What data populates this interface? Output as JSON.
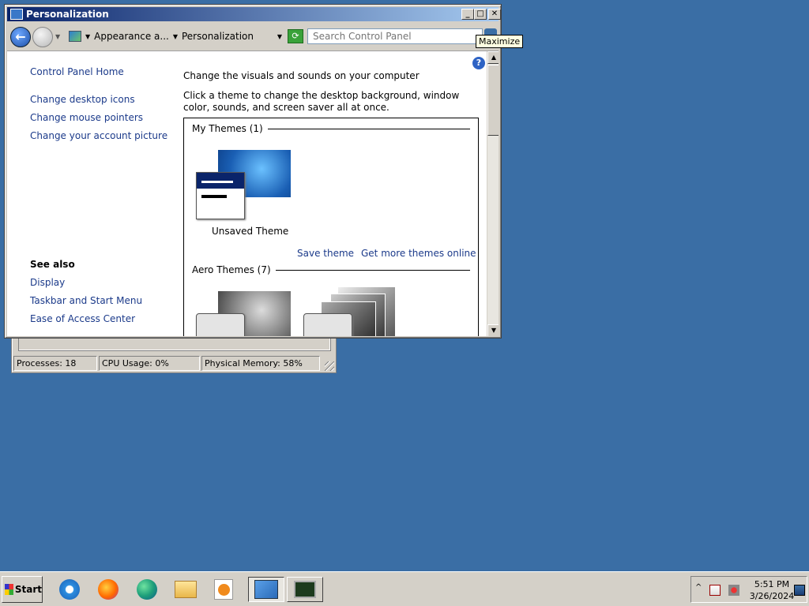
{
  "window": {
    "title": "Personalization",
    "minimize_glyph": "_",
    "maximize_glyph": "□",
    "close_glyph": "✕"
  },
  "navbar": {
    "back_glyph": "←",
    "breadcrumbs": [
      "Appearance a...",
      "Personalization"
    ],
    "search_placeholder": "Search Control Panel"
  },
  "tooltip": {
    "text": "Maximize"
  },
  "left_pane": {
    "links": [
      "Control Panel Home",
      "Change desktop icons",
      "Change mouse pointers",
      "Change your account picture"
    ],
    "see_also_title": "See also",
    "see_also": [
      "Display",
      "Taskbar and Start Menu",
      "Ease of Access Center"
    ]
  },
  "main": {
    "heading": "Change the visuals and sounds on your computer",
    "description": "Click a theme to change the desktop background, window color, sounds, and screen saver all at once.",
    "my_themes_label": "My Themes (1)",
    "unsaved_theme": "Unsaved Theme",
    "save_theme": "Save theme",
    "get_more": "Get more themes online",
    "aero_themes_label": "Aero Themes (7)"
  },
  "task_manager": {
    "processes": "Processes: 18",
    "cpu": "CPU Usage: 0%",
    "memory": "Physical Memory: 58%"
  },
  "taskbar": {
    "start_label": "Start",
    "apps": [
      "internet-explorer-icon",
      "firefox-icon",
      "edge-icon",
      "file-explorer-icon",
      "media-player-icon",
      "control-panel-icon",
      "task-manager-icon"
    ],
    "tray_chevron": "^",
    "clock_time": "5:51 PM",
    "clock_date": "3/26/2024"
  },
  "colors": {
    "desktop": "#3a6ea5",
    "link": "#1b3a8a",
    "titlebar_start": "#0a246a",
    "titlebar_end": "#a6caf0"
  }
}
